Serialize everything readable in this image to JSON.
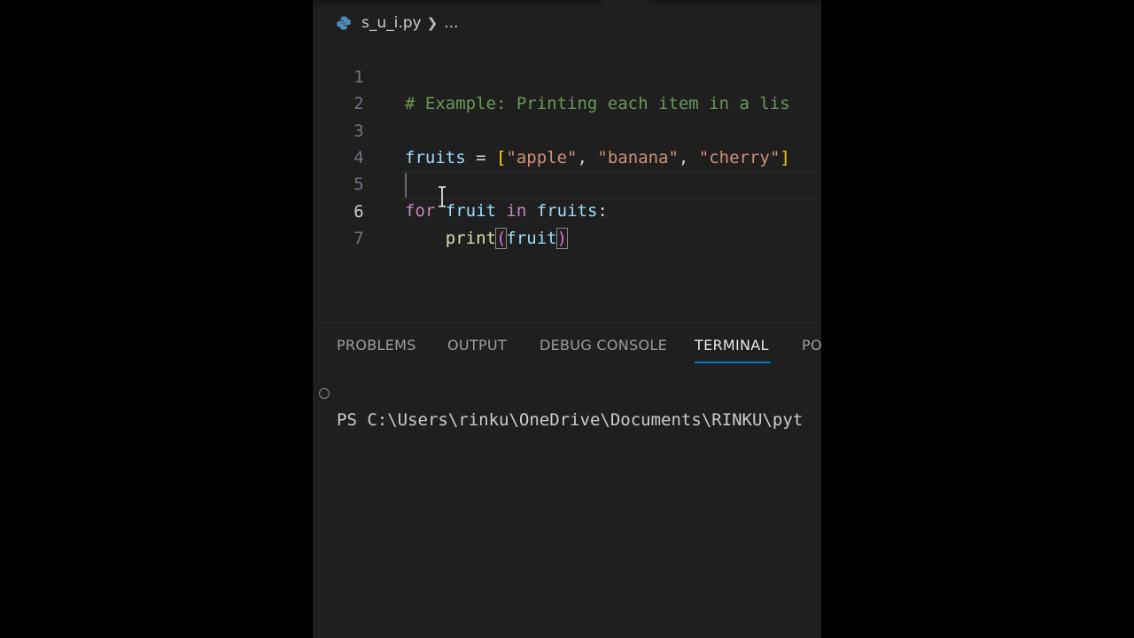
{
  "breadcrumb": {
    "file_name": "s_u_i.py",
    "ellipsis": "..."
  },
  "editor": {
    "active_line": 6,
    "lines": [
      {
        "number": "1",
        "text": "# Example: Printing each item in a lis"
      },
      {
        "number": "2",
        "text": ""
      },
      {
        "number": "3",
        "text": "fruits = [\"apple\", \"banana\", \"cherry\"]"
      },
      {
        "number": "4",
        "text": ""
      },
      {
        "number": "5",
        "text": "for fruit in fruits:"
      },
      {
        "number": "6",
        "text": "    print(fruit)"
      },
      {
        "number": "7",
        "text": ""
      }
    ],
    "tokens": {
      "l1_comment": "# Example: Printing each item in a lis",
      "l3_var": "fruits",
      "l3_eq": " = ",
      "l3_open": "[",
      "l3_s1": "\"apple\"",
      "l3_c1": ", ",
      "l3_s2": "\"banana\"",
      "l3_c2": ", ",
      "l3_s3": "\"cherry\"",
      "l3_close": "]",
      "l5_for": "for",
      "l5_sp1": " ",
      "l5_fruit": "fruit",
      "l5_in": " in ",
      "l5_fruits": "fruits",
      "l5_colon": ":",
      "l6_indent": "    ",
      "l6_print": "print",
      "l6_open": "(",
      "l6_arg": "fruit",
      "l6_close": ")"
    }
  },
  "panel": {
    "tabs": [
      {
        "label": "PROBLEMS",
        "active": false
      },
      {
        "label": "OUTPUT",
        "active": false
      },
      {
        "label": "DEBUG CONSOLE",
        "active": false
      },
      {
        "label": "TERMINAL",
        "active": true
      },
      {
        "label": "PO",
        "active": false
      }
    ]
  },
  "terminal": {
    "prompt": "PS C:\\Users\\rinku\\OneDrive\\Documents\\RINKU\\pyt"
  },
  "colors": {
    "comment": "#6a9955",
    "variable": "#9cdcfe",
    "string": "#ce9178",
    "keyword": "#c586c0",
    "function": "#dcdcaa",
    "bracket": "#ffd700",
    "accent": "#0078d4"
  },
  "icons": {
    "file_icon": "python-icon",
    "separator": "chevron-right-icon",
    "terminal_status": "circle-icon",
    "cursor": "ibeam-cursor-icon"
  }
}
